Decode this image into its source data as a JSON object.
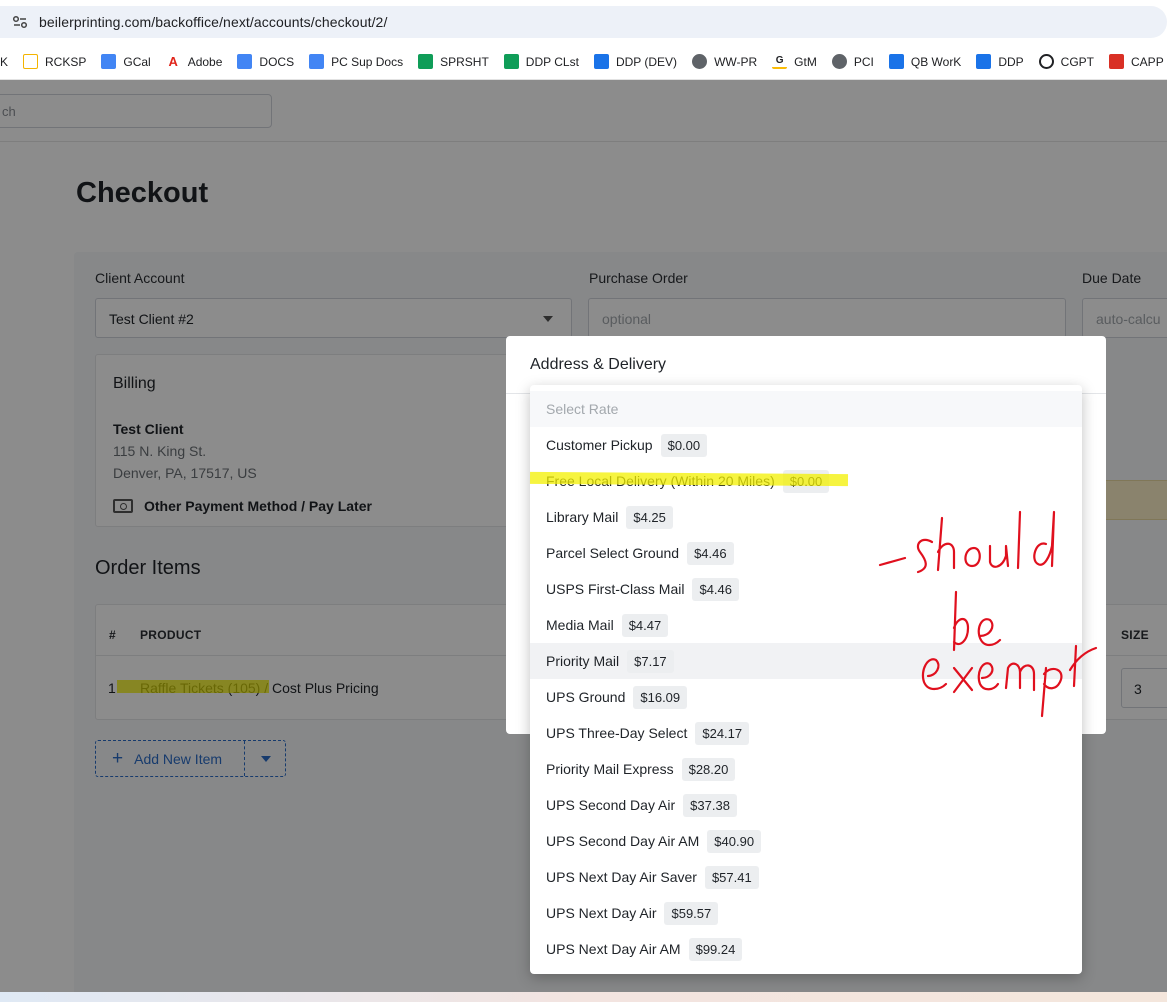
{
  "browser": {
    "url": "beilerprinting.com/backoffice/next/accounts/checkout/2/",
    "bookmarks": [
      {
        "label": "SK",
        "icon": "bookmark-icon",
        "color": "#ffffff"
      },
      {
        "label": "RCKSP",
        "icon": "mail-icon",
        "color": "#f4b400"
      },
      {
        "label": "GCal",
        "icon": "calendar-icon",
        "color": "#4285f4"
      },
      {
        "label": "Adobe",
        "icon": "adobe-icon",
        "color": "#e1251b"
      },
      {
        "label": "DOCS",
        "icon": "docs-icon",
        "color": "#4285f4"
      },
      {
        "label": "PC Sup Docs",
        "icon": "docs-icon",
        "color": "#4285f4"
      },
      {
        "label": "SPRSHT",
        "icon": "sheets-icon",
        "color": "#0f9d58"
      },
      {
        "label": "DDP CLst",
        "icon": "sheets-icon",
        "color": "#0f9d58"
      },
      {
        "label": "DDP (DEV)",
        "icon": "file-icon",
        "color": "#1a73e8"
      },
      {
        "label": "WW-PR",
        "icon": "globe-icon",
        "color": "#5f6368"
      },
      {
        "label": "GtM",
        "icon": "g-icon",
        "color": "#202124"
      },
      {
        "label": "PCI",
        "icon": "globe-icon",
        "color": "#5f6368"
      },
      {
        "label": "QB WorK",
        "icon": "info-icon",
        "color": "#1a73e8"
      },
      {
        "label": "DDP",
        "icon": "file-icon",
        "color": "#1a73e8"
      },
      {
        "label": "CGPT",
        "icon": "openai-icon",
        "color": "#202124"
      },
      {
        "label": "CAPP",
        "icon": "capp-icon",
        "color": "#d93025"
      }
    ]
  },
  "search": {
    "placeholder": "ch"
  },
  "page": {
    "title": "Checkout"
  },
  "form": {
    "client_account_label": "Client Account",
    "client_account_value": "Test Client  #2",
    "purchase_order_label": "Purchase Order",
    "purchase_order_placeholder": "optional",
    "due_date_label": "Due Date",
    "due_date_placeholder": "auto-calcu"
  },
  "billing": {
    "heading": "Billing",
    "name": "Test Client",
    "street": "115 N. King St.",
    "city": "Denver, PA, 17517, US",
    "payment": "Other Payment Method / Pay Later"
  },
  "order": {
    "heading": "Order Items",
    "columns": {
      "num": "#",
      "product": "PRODUCT",
      "size": "SIZE"
    },
    "rows": [
      {
        "num": "1",
        "product": "Raffle Tickets (105)",
        "pricing": " / Cost Plus Pricing",
        "size": "3"
      }
    ],
    "add_button": "Add New Item"
  },
  "modal": {
    "title": "Address & Delivery",
    "placeholder": "Select Rate",
    "options": [
      {
        "label": "Customer Pickup",
        "price": "$0.00"
      },
      {
        "label": "Free Local Delivery (Within 20 Miles)",
        "price": "$0.00"
      },
      {
        "label": "Library Mail",
        "price": "$4.25"
      },
      {
        "label": "Parcel Select Ground",
        "price": "$4.46"
      },
      {
        "label": "USPS First-Class Mail",
        "price": "$4.46"
      },
      {
        "label": "Media Mail",
        "price": "$4.47"
      },
      {
        "label": "Priority Mail",
        "price": "$7.17"
      },
      {
        "label": "UPS Ground",
        "price": "$16.09"
      },
      {
        "label": "UPS Three-Day Select",
        "price": "$24.17"
      },
      {
        "label": "Priority Mail Express",
        "price": "$28.20"
      },
      {
        "label": "UPS Second Day Air",
        "price": "$37.38"
      },
      {
        "label": "UPS Second Day Air AM",
        "price": "$40.90"
      },
      {
        "label": "UPS Next Day Air Saver",
        "price": "$57.41"
      },
      {
        "label": "UPS Next Day Air",
        "price": "$59.57"
      },
      {
        "label": "UPS Next Day Air AM",
        "price": "$99.24"
      }
    ],
    "hovered_option": "Priority Mail"
  },
  "annotation": {
    "handwritten_text": "-should be exempt",
    "ink_color": "#e0101e",
    "highlight_color": "#f3f000"
  }
}
